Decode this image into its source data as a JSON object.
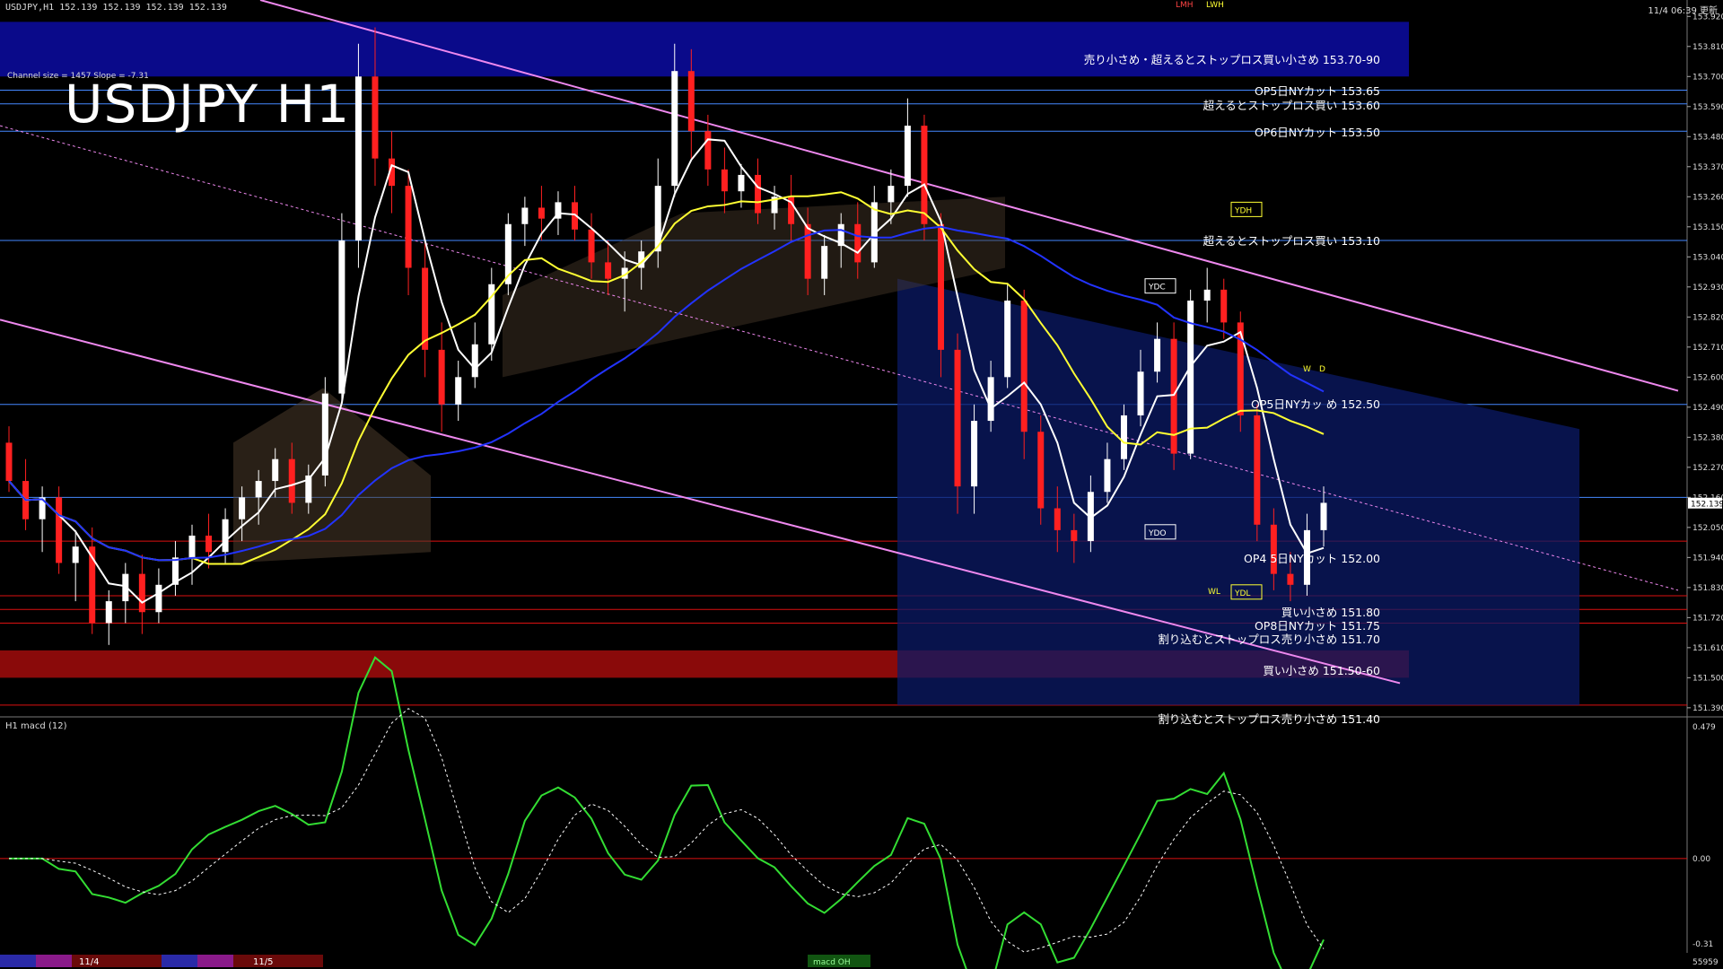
{
  "header": {
    "symbol_info": "USDJPY,H1  152.139 152.139 152.139 152.139",
    "timestamp": "11/4 06:39 更新"
  },
  "chart_title": "USDJPY H1",
  "channel_info": "Channel size = 1457 Slope = -7.31",
  "subwindow_title": "H1  macd (12)",
  "price_axis": {
    "ticks": [
      "153.920",
      "153.810",
      "153.700",
      "153.590",
      "153.480",
      "153.370",
      "153.260",
      "153.150",
      "153.040",
      "152.930",
      "152.820",
      "152.710",
      "152.600",
      "152.490",
      "152.380",
      "152.270",
      "152.160",
      "152.050",
      "151.940",
      "151.830",
      "151.720",
      "151.610",
      "151.500",
      "151.390"
    ],
    "current_price": "152.139"
  },
  "macd_axis": {
    "ticks": [
      "0.479",
      "0.00",
      "-0.31"
    ]
  },
  "levels": [
    {
      "label": "売り小さめ・超えるとストップロス買い小さめ 153.70-90"
    },
    {
      "label": "OP5日NYカット 153.65"
    },
    {
      "label": "超えるとストップロス買い 153.60"
    },
    {
      "label": "OP6日NYカット 153.50"
    },
    {
      "label": "超えるとストップロス買い 153.10"
    },
    {
      "label": "OP5日NYカッ  め 152.50"
    },
    {
      "label": "OP4  5日NYカット 152.00"
    },
    {
      "label": "買い小さめ 151.80"
    },
    {
      "label": "OP8日NYカット 151.75"
    },
    {
      "label": "割り込むとストップロス売り小さめ 151.70"
    },
    {
      "label": "買い小さめ 151.50-60"
    },
    {
      "label": "割り込むとストップロス売り小さめ 151.40"
    }
  ],
  "markers": {
    "ydc": "YDC",
    "ydo": "YDO",
    "ydh": "YDH",
    "ydl": "YDL",
    "lmh": "LMH",
    "lwh": "LWH",
    "lwl": "WL",
    "w": "W",
    "d": "D"
  },
  "footer": {
    "date1": "11/4",
    "date2": "11/5",
    "indicator_tag": "macd OH",
    "volume": "55959"
  },
  "colors": {
    "background": "#000000",
    "bull": "#ffffff",
    "bear": "#ff2020",
    "ma_fast": "#ffffff",
    "ma_mid": "#ffff33",
    "ma_slow": "#2233ff",
    "channel": "#ee88ee",
    "level": "#4488ff",
    "sell_zone": "#0a0a8a",
    "buy_zone": "#8a0a0a",
    "macd": "#33dd33",
    "signal": "#ffffff",
    "boll": "#dd1111",
    "rsi": "#22cc22"
  },
  "chart_data": {
    "type": "candlestick",
    "ylim": [
      151.36,
      153.98
    ],
    "candles": [
      [
        152.36,
        152.42,
        152.18,
        152.22
      ],
      [
        152.22,
        152.3,
        152.04,
        152.08
      ],
      [
        152.08,
        152.2,
        151.96,
        152.16
      ],
      [
        152.16,
        152.2,
        151.88,
        151.92
      ],
      [
        151.92,
        152.04,
        151.78,
        151.98
      ],
      [
        151.98,
        152.05,
        151.66,
        151.7
      ],
      [
        151.7,
        151.82,
        151.62,
        151.78
      ],
      [
        151.78,
        151.92,
        151.7,
        151.88
      ],
      [
        151.88,
        151.95,
        151.66,
        151.74
      ],
      [
        151.74,
        151.9,
        151.7,
        151.84
      ],
      [
        151.84,
        152.0,
        151.8,
        151.94
      ],
      [
        151.94,
        152.06,
        151.84,
        152.02
      ],
      [
        152.02,
        152.1,
        151.9,
        151.96
      ],
      [
        151.96,
        152.12,
        151.92,
        152.08
      ],
      [
        152.08,
        152.2,
        152.0,
        152.16
      ],
      [
        152.16,
        152.26,
        152.06,
        152.22
      ],
      [
        152.22,
        152.34,
        152.16,
        152.3
      ],
      [
        152.3,
        152.36,
        152.1,
        152.14
      ],
      [
        152.14,
        152.28,
        152.1,
        152.24
      ],
      [
        152.24,
        152.6,
        152.2,
        152.54
      ],
      [
        152.54,
        153.2,
        152.5,
        153.1
      ],
      [
        153.1,
        153.82,
        153.0,
        153.7
      ],
      [
        153.7,
        153.88,
        153.3,
        153.4
      ],
      [
        153.4,
        153.5,
        153.2,
        153.3
      ],
      [
        153.3,
        153.36,
        152.9,
        153.0
      ],
      [
        153.0,
        153.1,
        152.6,
        152.7
      ],
      [
        152.7,
        152.8,
        152.4,
        152.5
      ],
      [
        152.5,
        152.66,
        152.44,
        152.6
      ],
      [
        152.6,
        152.8,
        152.56,
        152.72
      ],
      [
        152.72,
        153.0,
        152.66,
        152.94
      ],
      [
        152.94,
        153.2,
        152.9,
        153.16
      ],
      [
        153.16,
        153.26,
        153.08,
        153.22
      ],
      [
        153.22,
        153.3,
        153.1,
        153.18
      ],
      [
        153.18,
        153.28,
        153.12,
        153.24
      ],
      [
        153.24,
        153.3,
        153.1,
        153.14
      ],
      [
        153.14,
        153.2,
        152.96,
        153.02
      ],
      [
        153.02,
        153.1,
        152.9,
        152.96
      ],
      [
        152.96,
        153.06,
        152.84,
        153.0
      ],
      [
        153.0,
        153.1,
        152.92,
        153.06
      ],
      [
        153.06,
        153.4,
        153.0,
        153.3
      ],
      [
        153.3,
        153.82,
        153.26,
        153.72
      ],
      [
        153.72,
        153.8,
        153.4,
        153.5
      ],
      [
        153.5,
        153.56,
        153.3,
        153.36
      ],
      [
        153.36,
        153.44,
        153.2,
        153.28
      ],
      [
        153.28,
        153.38,
        153.22,
        153.34
      ],
      [
        153.34,
        153.4,
        153.16,
        153.2
      ],
      [
        153.2,
        153.3,
        153.14,
        153.26
      ],
      [
        153.26,
        153.34,
        153.1,
        153.16
      ],
      [
        153.16,
        153.22,
        152.9,
        152.96
      ],
      [
        152.96,
        153.12,
        152.9,
        153.08
      ],
      [
        153.08,
        153.2,
        153.0,
        153.16
      ],
      [
        153.16,
        153.24,
        152.96,
        153.02
      ],
      [
        153.02,
        153.3,
        153.0,
        153.24
      ],
      [
        153.24,
        153.36,
        153.16,
        153.3
      ],
      [
        153.3,
        153.62,
        153.26,
        153.52
      ],
      [
        153.52,
        153.56,
        153.1,
        153.16
      ],
      [
        153.16,
        153.2,
        152.6,
        152.7
      ],
      [
        152.7,
        152.76,
        152.1,
        152.2
      ],
      [
        152.2,
        152.5,
        152.1,
        152.44
      ],
      [
        152.44,
        152.66,
        152.4,
        152.6
      ],
      [
        152.6,
        152.94,
        152.56,
        152.88
      ],
      [
        152.88,
        152.92,
        152.3,
        152.4
      ],
      [
        152.4,
        152.46,
        152.06,
        152.12
      ],
      [
        152.12,
        152.2,
        151.96,
        152.04
      ],
      [
        152.04,
        152.1,
        151.92,
        152.0
      ],
      [
        152.0,
        152.24,
        151.96,
        152.18
      ],
      [
        152.18,
        152.36,
        152.14,
        152.3
      ],
      [
        152.3,
        152.5,
        152.26,
        152.46
      ],
      [
        152.46,
        152.7,
        152.42,
        152.62
      ],
      [
        152.62,
        152.8,
        152.58,
        152.74
      ],
      [
        152.74,
        152.8,
        152.26,
        152.32
      ],
      [
        152.32,
        152.92,
        152.3,
        152.88
      ],
      [
        152.88,
        153.0,
        152.8,
        152.92
      ],
      [
        152.92,
        152.96,
        152.74,
        152.8
      ],
      [
        152.8,
        152.84,
        152.4,
        152.46
      ],
      [
        152.46,
        152.5,
        152.0,
        152.06
      ],
      [
        152.06,
        152.12,
        151.82,
        151.88
      ],
      [
        151.88,
        151.96,
        151.78,
        151.84
      ],
      [
        151.84,
        152.1,
        151.8,
        152.04
      ],
      [
        152.04,
        152.2,
        151.98,
        152.14
      ]
    ]
  }
}
